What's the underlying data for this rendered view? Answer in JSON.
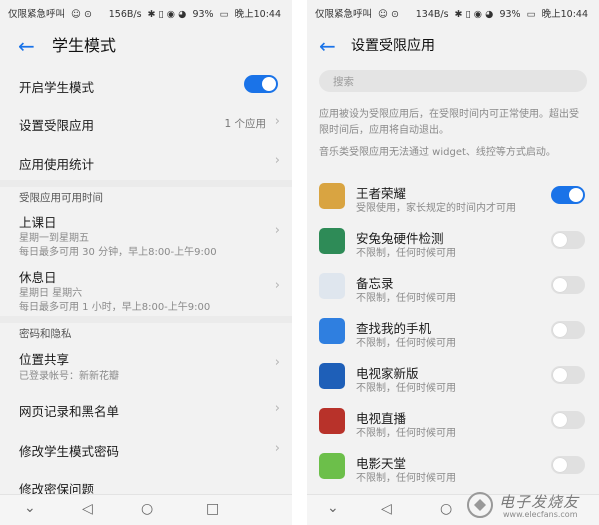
{
  "status_left": {
    "carrier": "仅限紧急呼叫",
    "speed": "156B/s",
    "battery": "93%",
    "time": "晚上10:44"
  },
  "status_right": {
    "carrier": "仅限紧急呼叫",
    "speed": "134B/s",
    "battery": "93%",
    "time": "晚上10:44"
  },
  "left_screen": {
    "title": "学生模式",
    "enable_label": "开启学生模式",
    "restricted_apps_label": "设置受限应用",
    "restricted_apps_value": "1 个应用",
    "usage_stats_label": "应用使用统计",
    "section_time": "受限应用可用时间",
    "school_day": {
      "label": "上课日",
      "line1": "星期一到星期五",
      "line2": "每日最多可用 30 分钟，早上8:00-上午9:00"
    },
    "rest_day": {
      "label": "休息日",
      "line1": "星期日  星期六",
      "line2": "每日最多可用 1 小时，早上8:00-上午9:00"
    },
    "section_privacy": "密码和隐私",
    "location": {
      "label": "位置共享",
      "line1": "已登录帐号：新新花瓣"
    },
    "web_history_label": "网页记录和黑名单",
    "change_password_label": "修改学生模式密码",
    "change_security_label": "修改密保问题"
  },
  "right_screen": {
    "title": "设置受限应用",
    "search_placeholder": "搜索",
    "desc1": "应用被设为受限应用后，在受限时间内可正常使用。超出受限时间后，应用将自动退出。",
    "desc2": "音乐类受限应用无法通过 widget、线控等方式启动。",
    "apps": [
      {
        "name": "王者荣耀",
        "desc": "受限使用，家长规定的时间内才可用",
        "enabled": true,
        "color": "#d9a441"
      },
      {
        "name": "安兔兔硬件检测",
        "desc": "不限制，任何时候可用",
        "enabled": false,
        "color": "#2e8b57"
      },
      {
        "name": "备忘录",
        "desc": "不限制，任何时候可用",
        "enabled": false,
        "color": "#dfe6ee"
      },
      {
        "name": "查找我的手机",
        "desc": "不限制，任何时候可用",
        "enabled": false,
        "color": "#2f7fe0"
      },
      {
        "name": "电视家新版",
        "desc": "不限制，任何时候可用",
        "enabled": false,
        "color": "#1e5fb8"
      },
      {
        "name": "电视直播",
        "desc": "不限制，任何时候可用",
        "enabled": false,
        "color": "#b8322a"
      },
      {
        "name": "电影天堂",
        "desc": "不限制，任何时候可用",
        "enabled": false,
        "color": "#6cbf4a"
      }
    ]
  },
  "watermark": {
    "text": "电子发烧友",
    "url": "www.elecfans.com"
  },
  "colors": {
    "accent": "#1a73e8",
    "background": "#f2f2f2"
  }
}
